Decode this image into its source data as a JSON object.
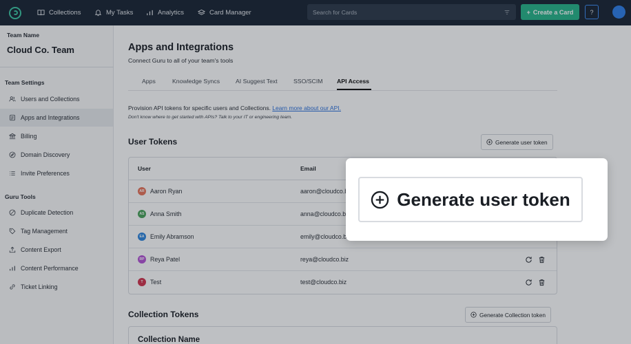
{
  "nav": {
    "collections": "Collections",
    "my_tasks": "My Tasks",
    "analytics": "Analytics",
    "card_manager": "Card Manager",
    "search_placeholder": "Search for Cards",
    "create_card": "Create a Card",
    "help": "?"
  },
  "sidebar": {
    "team_label": "Team Name",
    "team_name": "Cloud Co. Team",
    "team_settings_title": "Team Settings",
    "team_settings": [
      "Users and Collections",
      "Apps and Integrations",
      "Billing",
      "Domain Discovery",
      "Invite Preferences"
    ],
    "guru_tools_title": "Guru Tools",
    "guru_tools": [
      "Duplicate Detection",
      "Tag Management",
      "Content Export",
      "Content Performance",
      "Ticket Linking"
    ]
  },
  "main": {
    "title": "Apps and Integrations",
    "subtitle": "Connect Guru to all of your team's tools",
    "tabs": [
      "Apps",
      "Knowledge Syncs",
      "AI Suggest Text",
      "SSO/SCIM",
      "API Access"
    ],
    "active_tab": "API Access",
    "intro_text": "Provision API tokens for specific users and Collections. ",
    "intro_link": "Learn more about our API.",
    "intro_small": "Don't know where to get started with APIs? Talk to your IT or engineering team.",
    "user_tokens_title": "User Tokens",
    "generate_user_token": "Generate user token",
    "columns": {
      "user": "User",
      "email": "Email"
    },
    "users": [
      {
        "initials": "AR",
        "name": "Aaron Ryan",
        "email": "aaron@cloudco.biz",
        "color": "#e8735a"
      },
      {
        "initials": "AS",
        "name": "Anna Smith",
        "email": "anna@cloudco.b",
        "color": "#4aa35a"
      },
      {
        "initials": "EA",
        "name": "Emily Abramson",
        "email": "emily@cloudco.b",
        "color": "#2e86de"
      },
      {
        "initials": "RP",
        "name": "Reya Patel",
        "email": "reya@cloudco.biz",
        "color": "#b455d6"
      },
      {
        "initials": "T",
        "name": "Test",
        "email": "test@cloudco.biz",
        "color": "#d1344e"
      }
    ],
    "collection_tokens_title": "Collection Tokens",
    "generate_collection_token": "Generate Collection token",
    "collection_name_header": "Collection Name"
  },
  "callout": {
    "label": "Generate user token"
  }
}
